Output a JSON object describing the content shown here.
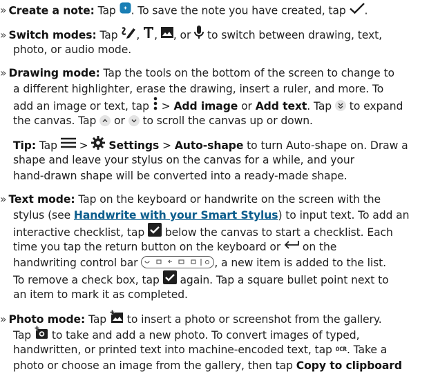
{
  "bullet": "»",
  "lines": [
    {
      "a": "Create a note:",
      "b": " Tap ",
      "c": ". To save the note you have created, tap "
    },
    {
      "a": "Switch modes:",
      "b": " Tap ",
      "c": ", ",
      "d": ", ",
      "e": ", or ",
      "f": " to switch between drawing, text,"
    },
    {
      "t": "photo, or audio mode."
    },
    {
      "a": "Drawing mode:",
      "b": " Tap the tools on the bottom of the screen to change to"
    },
    {
      "t": "a different highlighter, erase the drawing, insert a ruler, and more. To"
    },
    {
      "a": "add an image or text, tap ",
      "b": " > ",
      "c": "Add image",
      "d": " or ",
      "e": "Add text",
      "f": ". Tap ",
      "g": " to expand"
    },
    {
      "a": "the canvas. Tap ",
      "b": " or ",
      "c": " to scroll the canvas up or down."
    },
    {
      "a": "Tip:",
      "b": " Tap ",
      "c": " > ",
      "d": "Settings",
      "e": " > ",
      "f": "Auto-shape",
      "g": " to turn Auto-shape on. Draw a"
    },
    {
      "t": "shape and leave your stylus on the canvas for a while, and your"
    },
    {
      "t": "hand-drawn shape will be converted into a ready-made shape."
    },
    {
      "a": "Text mode:",
      "b": " Tap on the keyboard or handwrite on the screen with the"
    },
    {
      "a": "stylus (see ",
      "b": "Handwrite with your Smart Stylus",
      "c": ") to input text. To add an"
    },
    {
      "a": "interactive checklist, tap ",
      "b": " below the canvas to start a checklist. Each"
    },
    {
      "a": "time you tap the return button on the keyboard or ",
      "b": " on the"
    },
    {
      "a": "handwriting control bar ",
      "b": ", a new item is added to the list."
    },
    {
      "a": "To remove a check box, tap ",
      "b": " again. Tap a square bullet point next to"
    },
    {
      "t": "an item to mark it as completed."
    },
    {
      "a": "Photo mode:",
      "b": " Tap ",
      "c": " to insert a photo or screenshot from the gallery."
    },
    {
      "a": "Tap ",
      "b": " to take and add a new photo. To convert images of typed,"
    },
    {
      "a": "handwritten, or printed text into machine-encoded text, tap ",
      "b": "OCR",
      "c": ". Take a"
    },
    {
      "a": "photo or choose an image from the gallery, then tap ",
      "b": "Copy to clipboard"
    }
  ],
  "colors": {
    "accent_blue": "#1a7fb5",
    "link_blue": "#0a5c8c",
    "text": "#1f1f1f"
  }
}
